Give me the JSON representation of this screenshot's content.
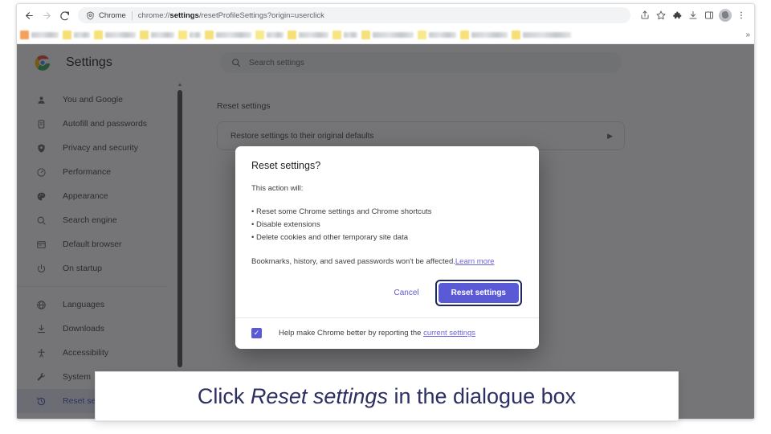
{
  "browser": {
    "nav": {
      "back_icon": "arrow-left-icon",
      "forward_icon": "arrow-right-icon",
      "reload_icon": "reload-icon"
    },
    "omnibox": {
      "badge_icon": "chrome-shield-icon",
      "scheme_label": "Chrome",
      "url_prefix": "chrome://",
      "url_bold": "settings",
      "url_suffix": "/resetProfileSettings?origin=userclick",
      "full_url": "chrome://settings/resetProfileSettings?origin=userclick"
    },
    "toolbar_icons": [
      "share-icon",
      "bookmark-star-icon",
      "extensions-puzzle-icon",
      "downloads-icon",
      "side-panel-icon",
      "profile-avatar-icon",
      "more-menu-icon"
    ],
    "bookmarks": {
      "overflow_label": "»",
      "items": [
        {
          "favicon_color": "#f3a05c",
          "label_width": 34
        },
        {
          "favicon_color": "#f6df74",
          "label_width": 20
        },
        {
          "favicon_color": "#f7e178",
          "label_width": 38
        },
        {
          "favicon_color": "#f6e07a",
          "label_width": 29
        },
        {
          "favicon_color": "#f8e784",
          "label_width": 14
        },
        {
          "favicon_color": "#f6e07a",
          "label_width": 44
        },
        {
          "favicon_color": "#f9e98c",
          "label_width": 21
        },
        {
          "favicon_color": "#f6df74",
          "label_width": 37
        },
        {
          "favicon_color": "#f8e482",
          "label_width": 17
        },
        {
          "favicon_color": "#f6e07a",
          "label_width": 51
        },
        {
          "favicon_color": "#f9e98c",
          "label_width": 34
        },
        {
          "favicon_color": "#f7e178",
          "label_width": 45
        },
        {
          "favicon_color": "#f6df74",
          "label_width": 60
        }
      ]
    }
  },
  "settings": {
    "logo_icon": "chrome-logo-icon",
    "title": "Settings",
    "search": {
      "icon": "search-icon",
      "placeholder": "Search settings",
      "value": ""
    },
    "sidebar": {
      "items": [
        {
          "label": "You and Google",
          "icon": "person-icon",
          "active": false
        },
        {
          "label": "Autofill and passwords",
          "icon": "clipboard-icon",
          "active": false
        },
        {
          "label": "Privacy and security",
          "icon": "shield-icon",
          "active": false
        },
        {
          "label": "Performance",
          "icon": "speedometer-icon",
          "active": false
        },
        {
          "label": "Appearance",
          "icon": "palette-icon",
          "active": false
        },
        {
          "label": "Search engine",
          "icon": "search-icon",
          "active": false
        },
        {
          "label": "Default browser",
          "icon": "browser-window-icon",
          "active": false
        },
        {
          "label": "On startup",
          "icon": "power-icon",
          "active": false
        }
      ],
      "items2": [
        {
          "label": "Languages",
          "icon": "globe-icon",
          "active": false
        },
        {
          "label": "Downloads",
          "icon": "download-icon",
          "active": false
        },
        {
          "label": "Accessibility",
          "icon": "accessibility-icon",
          "active": false
        },
        {
          "label": "System",
          "icon": "wrench-icon",
          "active": false
        },
        {
          "label": "Reset settings",
          "icon": "history-icon",
          "active": true
        }
      ],
      "scrollbar": {
        "up_arrow_icon": "triangle-up-icon"
      }
    },
    "main": {
      "section_title": "Reset settings",
      "row_label": "Restore settings to their original defaults",
      "row_chevron_icon": "chevron-right-icon"
    }
  },
  "dialog": {
    "title": "Reset settings?",
    "intro": "This action will:",
    "bullets": [
      "• Reset some Chrome settings and Chrome shortcuts",
      "• Disable extensions",
      "• Delete cookies and other temporary site data"
    ],
    "note_text": "Bookmarks, history, and saved passwords won't be affected.",
    "learn_more_label": "Learn more",
    "cancel_label": "Cancel",
    "confirm_label": "Reset settings",
    "checkbox": {
      "checked": true,
      "check_glyph": "✓",
      "label_text": "Help make Chrome better by reporting the ",
      "link_label": "current settings"
    },
    "colors": {
      "confirm_button_bg": "#5a5ad6",
      "focus_ring": "#1f2a5c",
      "link": "#6c63d8"
    }
  },
  "caption": {
    "prefix": "Click ",
    "emphasis": "Reset settings",
    "suffix": " in the dialogue box",
    "color": "#2b2f63"
  }
}
